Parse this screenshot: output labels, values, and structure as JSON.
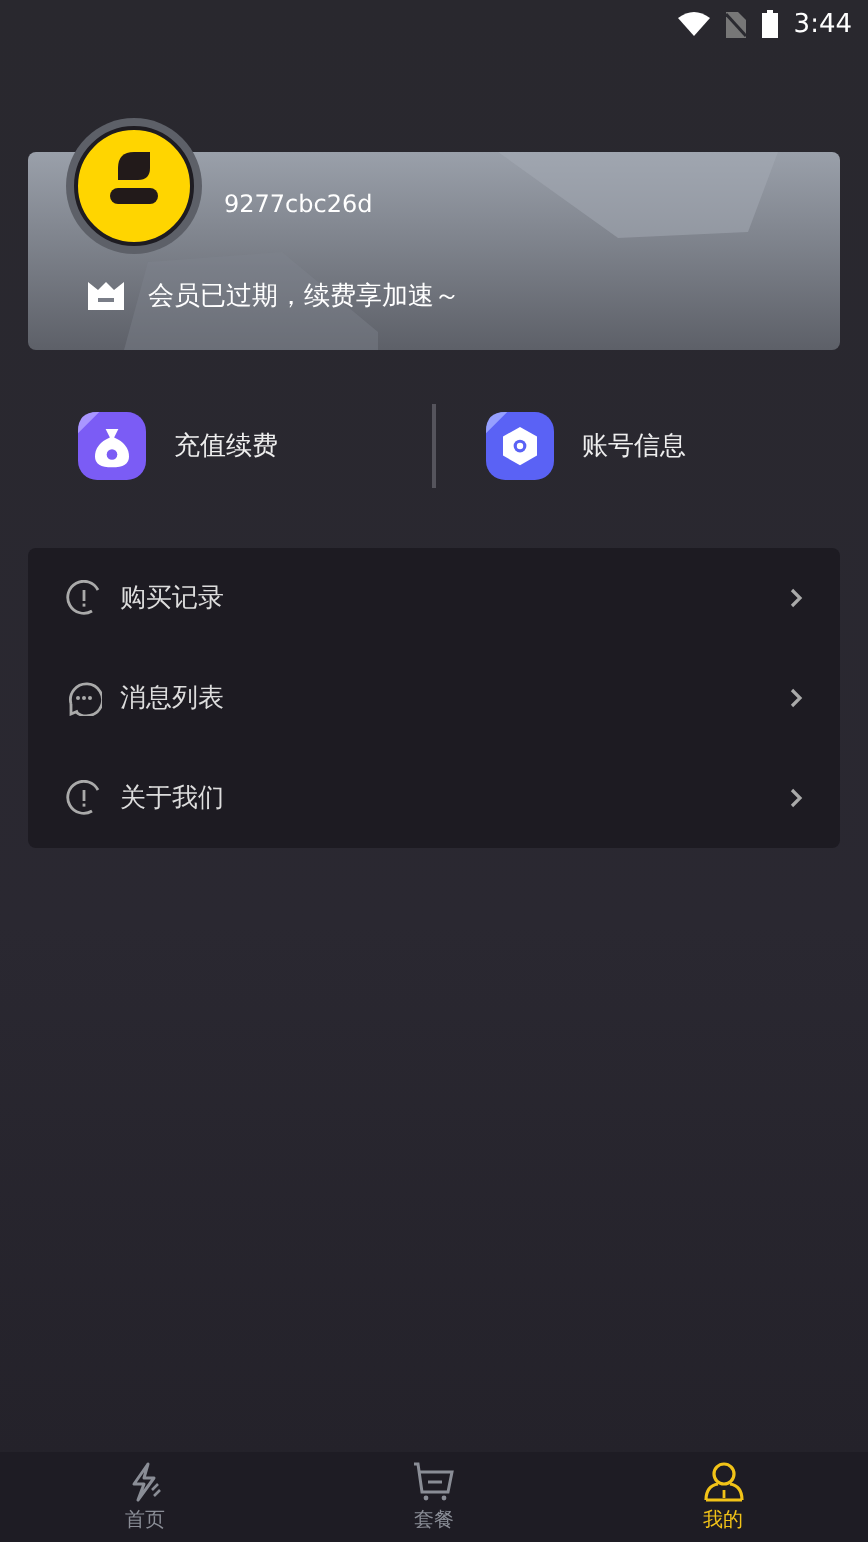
{
  "status_bar": {
    "time": "3:44"
  },
  "profile": {
    "username": "9277cbc26d",
    "membership": "会员已过期，续费享加速～"
  },
  "shortcuts": [
    {
      "kind": "recharge",
      "label": "充值续费"
    },
    {
      "kind": "account",
      "label": "账号信息"
    }
  ],
  "menu": [
    {
      "kind": "alert",
      "label": "购买记录"
    },
    {
      "kind": "chat",
      "label": "消息列表"
    },
    {
      "kind": "alert",
      "label": "关于我们"
    }
  ],
  "tabs": [
    {
      "kind": "bolt",
      "label": "首页",
      "selected": false
    },
    {
      "kind": "cart",
      "label": "套餐",
      "selected": false
    },
    {
      "kind": "person",
      "label": "我的",
      "selected": true
    }
  ]
}
